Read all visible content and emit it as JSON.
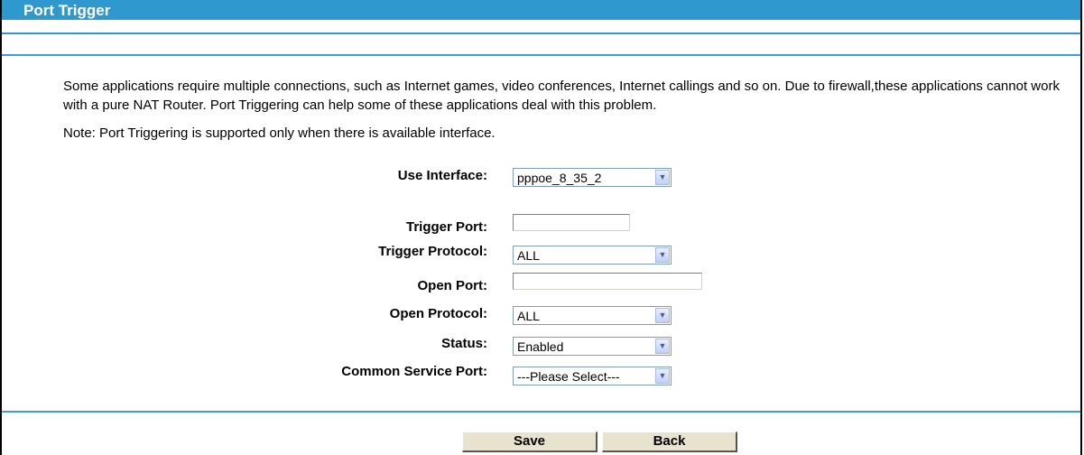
{
  "page": {
    "title": "Port Trigger",
    "description": "Some applications require multiple connections, such as Internet games, video conferences, Internet callings and so on. Due to firewall,these applications cannot work with a pure NAT Router. Port Triggering can help some of these applications deal with this problem.",
    "note": "Note: Port Triggering is supported only when there is available interface."
  },
  "form": {
    "use_interface": {
      "label": "Use Interface:",
      "value": "pppoe_8_35_2"
    },
    "trigger_port": {
      "label": "Trigger Port:",
      "value": ""
    },
    "trigger_protocol": {
      "label": "Trigger Protocol:",
      "value": "ALL"
    },
    "open_port": {
      "label": "Open Port:",
      "value": ""
    },
    "open_protocol": {
      "label": "Open Protocol:",
      "value": "ALL"
    },
    "status": {
      "label": "Status:",
      "value": "Enabled"
    },
    "common_service_port": {
      "label": "Common Service Port:",
      "value": "---Please Select---"
    }
  },
  "buttons": {
    "save": "Save",
    "back": "Back"
  }
}
